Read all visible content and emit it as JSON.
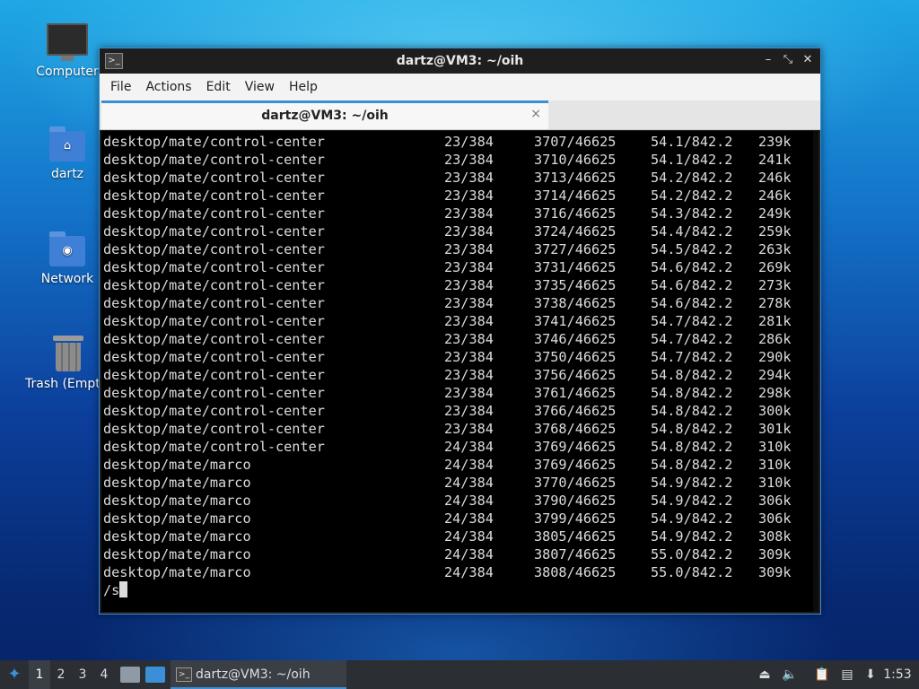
{
  "desktop": {
    "icons": [
      {
        "label": "Computer",
        "icon": "computer-icon"
      },
      {
        "label": "dartz",
        "icon": "home-folder-icon"
      },
      {
        "label": "Network",
        "icon": "network-folder-icon"
      },
      {
        "label": "Trash (Empt",
        "icon": "trash-icon"
      }
    ]
  },
  "window": {
    "title": "dartz@VM3: ~/oih",
    "menu": [
      "File",
      "Actions",
      "Edit",
      "View",
      "Help"
    ],
    "tab_label": "dartz@VM3: ~/oih",
    "tab_close": "×",
    "controls": {
      "minimize": "–",
      "restore": "⤡",
      "close": "✕"
    }
  },
  "terminal": {
    "rows": [
      [
        "desktop/mate/control-center",
        "23/384",
        "3707/46625",
        "54.1/842.2",
        "239k"
      ],
      [
        "desktop/mate/control-center",
        "23/384",
        "3710/46625",
        "54.1/842.2",
        "241k"
      ],
      [
        "desktop/mate/control-center",
        "23/384",
        "3713/46625",
        "54.2/842.2",
        "246k"
      ],
      [
        "desktop/mate/control-center",
        "23/384",
        "3714/46625",
        "54.2/842.2",
        "246k"
      ],
      [
        "desktop/mate/control-center",
        "23/384",
        "3716/46625",
        "54.3/842.2",
        "249k"
      ],
      [
        "desktop/mate/control-center",
        "23/384",
        "3724/46625",
        "54.4/842.2",
        "259k"
      ],
      [
        "desktop/mate/control-center",
        "23/384",
        "3727/46625",
        "54.5/842.2",
        "263k"
      ],
      [
        "desktop/mate/control-center",
        "23/384",
        "3731/46625",
        "54.6/842.2",
        "269k"
      ],
      [
        "desktop/mate/control-center",
        "23/384",
        "3735/46625",
        "54.6/842.2",
        "273k"
      ],
      [
        "desktop/mate/control-center",
        "23/384",
        "3738/46625",
        "54.6/842.2",
        "278k"
      ],
      [
        "desktop/mate/control-center",
        "23/384",
        "3741/46625",
        "54.7/842.2",
        "281k"
      ],
      [
        "desktop/mate/control-center",
        "23/384",
        "3746/46625",
        "54.7/842.2",
        "286k"
      ],
      [
        "desktop/mate/control-center",
        "23/384",
        "3750/46625",
        "54.7/842.2",
        "290k"
      ],
      [
        "desktop/mate/control-center",
        "23/384",
        "3756/46625",
        "54.8/842.2",
        "294k"
      ],
      [
        "desktop/mate/control-center",
        "23/384",
        "3761/46625",
        "54.8/842.2",
        "298k"
      ],
      [
        "desktop/mate/control-center",
        "23/384",
        "3766/46625",
        "54.8/842.2",
        "300k"
      ],
      [
        "desktop/mate/control-center",
        "23/384",
        "3768/46625",
        "54.8/842.2",
        "301k"
      ],
      [
        "desktop/mate/control-center",
        "24/384",
        "3769/46625",
        "54.8/842.2",
        "310k"
      ],
      [
        "desktop/mate/marco",
        "24/384",
        "3769/46625",
        "54.8/842.2",
        "310k"
      ],
      [
        "desktop/mate/marco",
        "24/384",
        "3770/46625",
        "54.9/842.2",
        "310k"
      ],
      [
        "desktop/mate/marco",
        "24/384",
        "3790/46625",
        "54.9/842.2",
        "306k"
      ],
      [
        "desktop/mate/marco",
        "24/384",
        "3799/46625",
        "54.9/842.2",
        "306k"
      ],
      [
        "desktop/mate/marco",
        "24/384",
        "3805/46625",
        "54.9/842.2",
        "308k"
      ],
      [
        "desktop/mate/marco",
        "24/384",
        "3807/46625",
        "55.0/842.2",
        "309k"
      ],
      [
        "desktop/mate/marco",
        "24/384",
        "3808/46625",
        "55.0/842.2",
        "309k"
      ]
    ],
    "prompt": "/s"
  },
  "taskbar": {
    "workspaces": [
      "1",
      "2",
      "3",
      "4"
    ],
    "active_workspace": "1",
    "task_label": "dartz@VM3: ~/oih",
    "clock": "1:53",
    "tray_icons": [
      "eject-icon",
      "volume-icon",
      "clipboard-icon",
      "network-icon",
      "update-icon"
    ]
  },
  "colors": {
    "accent": "#3b8fd6",
    "terminal_bg": "#000000",
    "terminal_fg": "#dcdcdc"
  }
}
